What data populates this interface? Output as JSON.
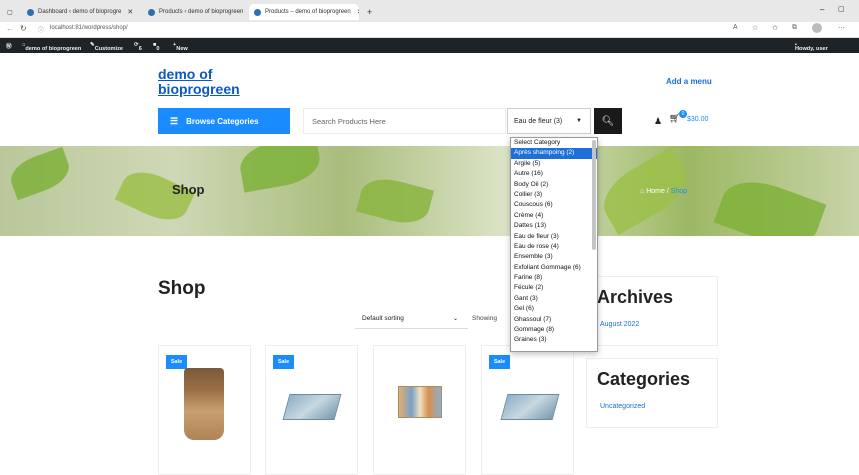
{
  "browser": {
    "tabs": [
      {
        "label": "Dashboard ‹ demo of bioprogre"
      },
      {
        "label": "Products ‹ demo of bioprogreen"
      },
      {
        "label": "Products – demo of bioprogreen"
      }
    ],
    "new_tab": "+",
    "url": "localhost:81/wordpress/shop/"
  },
  "wpbar": {
    "site": "demo of bioprogreen",
    "customize": "Customize",
    "comments": "6",
    "updates": "0",
    "new": "New",
    "howdy": "Howdy, user"
  },
  "site": {
    "logo_line1": "demo of",
    "logo_line2": "bioprogreen",
    "add_menu": "Add a menu",
    "browse": "Browse Categories",
    "search_placeholder": "Search Products Here",
    "category_selected": "Eau de fleur  (3)",
    "cart_count": "0",
    "cart_total": "$30.00"
  },
  "banner": {
    "title": "Shop",
    "crumb_home": "Home",
    "crumb_sep": " / ",
    "crumb_current": "Shop"
  },
  "main": {
    "heading": "Shop",
    "sorting": "Default sorting",
    "showing": "Showing",
    "sale_label": "Sale"
  },
  "sidebar": {
    "archives_title": "Archives",
    "archives_item": "August 2022",
    "categories_title": "Categories",
    "categories_item": "Uncategorized"
  },
  "dropdown": {
    "options": [
      "Select Category",
      "Après shampoing  (2)",
      "Argile  (5)",
      "Autre  (16)",
      "Body Oil  (2)",
      "Collier  (3)",
      "Couscous  (6)",
      "Crème  (4)",
      "Dattes  (13)",
      "Eau de fleur  (3)",
      "Eau de rose  (4)",
      "Ensemble  (3)",
      "Exfoliant Gommage  (6)",
      "Farine  (8)",
      "Fécule  (2)",
      "Gant  (3)",
      "Gel  (6)",
      "Ghassoul  (7)",
      "Gommage  (8)",
      "Graines  (3)"
    ],
    "highlighted_index": 1
  },
  "colors": {
    "accent": "#1a8cff",
    "wpbar": "#1d2327"
  }
}
